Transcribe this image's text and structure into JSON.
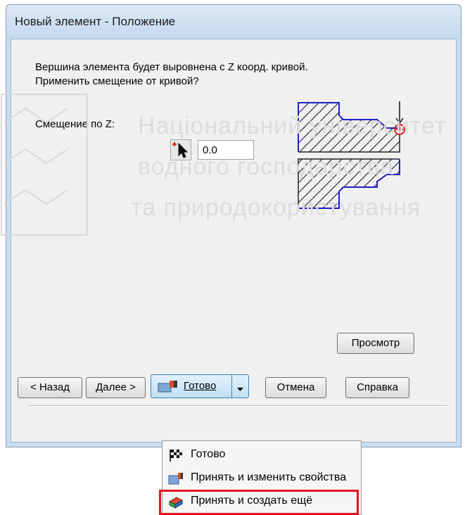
{
  "window": {
    "title": "Новый элемент - Положение"
  },
  "message": {
    "line1": "Вершина элемента будет выровнена с Z коорд. кривой.",
    "line2": "Применить смещение от кривой?"
  },
  "offset": {
    "label": "Смещение по Z:",
    "value": "0.0",
    "pick_icon": "cursor-pick-icon"
  },
  "buttons": {
    "back": "< Назад",
    "next": "Далее >",
    "done": "Готово",
    "cancel": "Отмена",
    "help": "Справка",
    "preview": "Просмотр"
  },
  "dropdown_menu": {
    "items": [
      {
        "label": "Готово",
        "icon": "checkered-flag-icon"
      },
      {
        "label": "Принять и изменить свойства",
        "icon": "accept-edit-icon"
      },
      {
        "label": "Принять и создать ещё",
        "icon": "accept-create-icon"
      }
    ],
    "highlighted_index": 2
  },
  "watermark": {
    "line1": "Національний університет",
    "line2": "водного господарства",
    "line3": "та природокористування"
  },
  "colors": {
    "highlight_border": "#e0141e",
    "diagram_outline": "#2020c0",
    "target_marker": "#e02020"
  }
}
